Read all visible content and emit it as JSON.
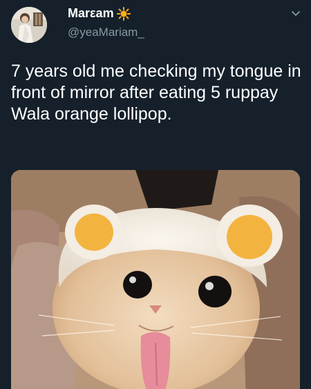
{
  "user": {
    "display_name": "Marεam",
    "handle": "@yeaMariam_",
    "name_emoji": "sun-icon"
  },
  "tweet": {
    "text": "7 years old me checking my tongue in front of mirror after eating 5 ruppay Wala orange lollipop."
  },
  "icons": {
    "more": "chevron-down-icon"
  },
  "colors": {
    "background": "#15202b",
    "secondary_text": "#8899a6",
    "sun": "#ffad1f"
  }
}
